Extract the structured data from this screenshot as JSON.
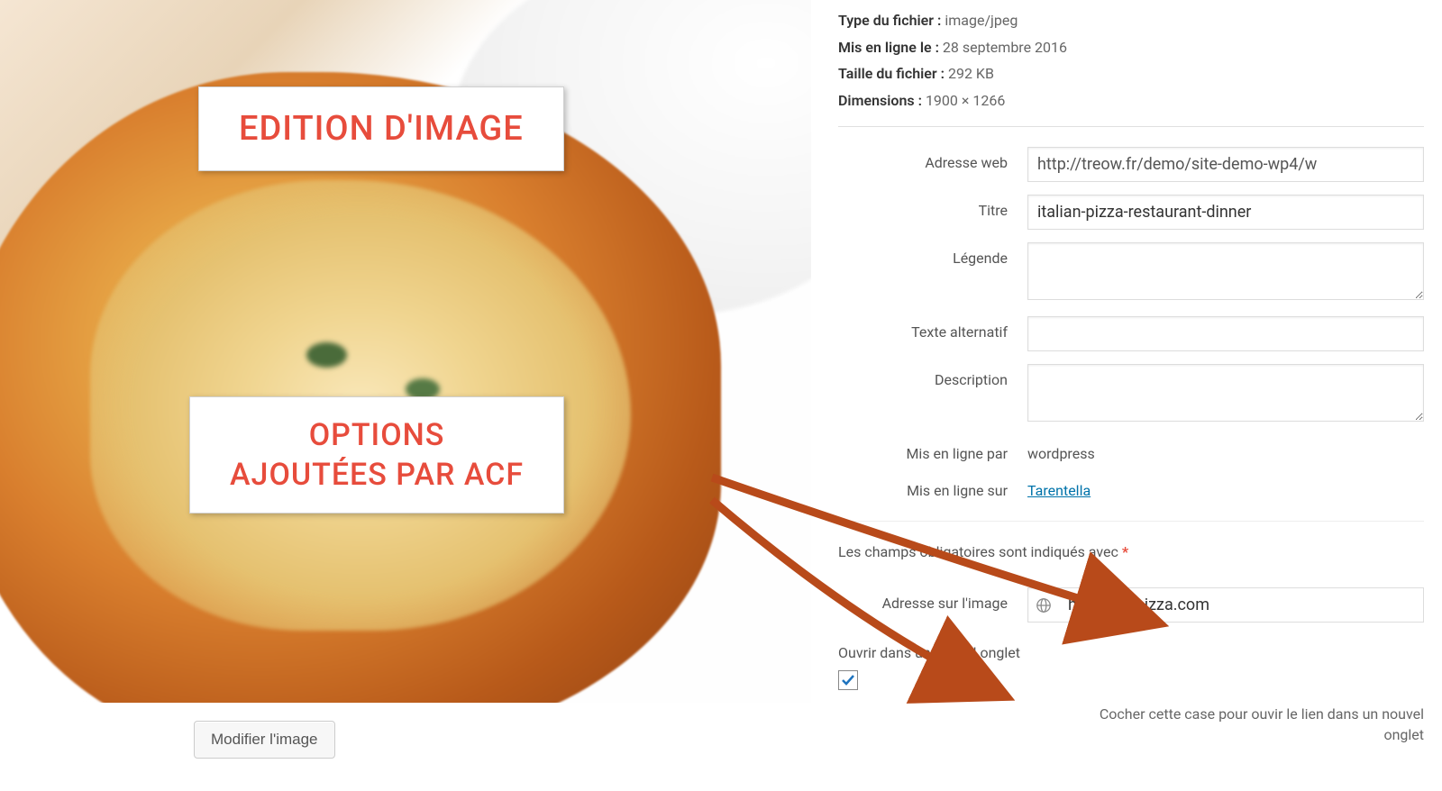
{
  "overlays": {
    "edition_label": "EDITION D'IMAGE",
    "acf_label_line1": "OPTIONS",
    "acf_label_line2": "AJOUTÉES PAR ACF"
  },
  "edit_button": "Modifier l'image",
  "meta": {
    "filetype_label": "Type du fichier :",
    "filetype_value": "image/jpeg",
    "uploaded_label": "Mis en ligne le :",
    "uploaded_value": "28 septembre 2016",
    "filesize_label": "Taille du fichier :",
    "filesize_value": "292 KB",
    "dimensions_label": "Dimensions :",
    "dimensions_value": "1900 × 1266"
  },
  "fields": {
    "url_label": "Adresse web",
    "url_value": "http://treow.fr/demo/site-demo-wp4/w",
    "title_label": "Titre",
    "title_value": "italian-pizza-restaurant-dinner",
    "caption_label": "Légende",
    "caption_value": "",
    "alt_label": "Texte alternatif",
    "alt_value": "",
    "description_label": "Description",
    "description_value": "",
    "uploaded_by_label": "Mis en ligne par",
    "uploaded_by_value": "wordpress",
    "uploaded_to_label": "Mis en ligne sur",
    "uploaded_to_value": "Tarentella"
  },
  "required_note": "Les champs obligatoires sont indiqués avec",
  "acf": {
    "image_link_label": "Adresse sur l'image",
    "image_link_value": "http://mapizza.com",
    "new_tab_label": "Ouvrir dans un nouvel onglet",
    "new_tab_checked": true,
    "new_tab_helper": "Cocher cette case pour ouvir le lien dans un nouvel onglet"
  }
}
